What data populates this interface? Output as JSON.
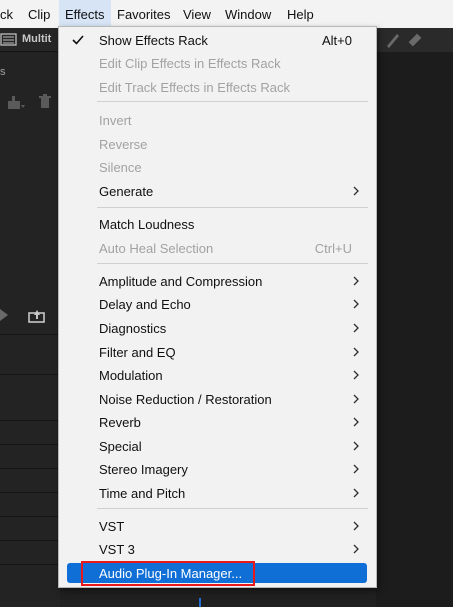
{
  "menubar": {
    "items": [
      {
        "label": "ck"
      },
      {
        "label": "Clip"
      },
      {
        "label": "Effects"
      },
      {
        "label": "Favorites"
      },
      {
        "label": "View"
      },
      {
        "label": "Window"
      },
      {
        "label": "Help"
      }
    ],
    "active_item": "Effects"
  },
  "background": {
    "tab_label": "Multit",
    "left_subheading": "s"
  },
  "effects_menu": {
    "items": [
      {
        "label": "Show Effects Rack",
        "shortcut": "Alt+0",
        "checked": true,
        "enabled": true
      },
      {
        "label": "Edit Clip Effects in Effects Rack",
        "enabled": false
      },
      {
        "label": "Edit Track Effects in Effects Rack",
        "enabled": false
      },
      {
        "label": "Invert",
        "enabled": false
      },
      {
        "label": "Reverse",
        "enabled": false
      },
      {
        "label": "Silence",
        "enabled": false
      },
      {
        "label": "Generate",
        "enabled": true,
        "submenu": true
      },
      {
        "label": "Match Loudness",
        "enabled": true
      },
      {
        "label": "Auto Heal Selection",
        "shortcut": "Ctrl+U",
        "enabled": false
      },
      {
        "label": "Amplitude and Compression",
        "enabled": true,
        "submenu": true
      },
      {
        "label": "Delay and Echo",
        "enabled": true,
        "submenu": true
      },
      {
        "label": "Diagnostics",
        "enabled": true,
        "submenu": true
      },
      {
        "label": "Filter and EQ",
        "enabled": true,
        "submenu": true
      },
      {
        "label": "Modulation",
        "enabled": true,
        "submenu": true
      },
      {
        "label": "Noise Reduction / Restoration",
        "enabled": true,
        "submenu": true
      },
      {
        "label": "Reverb",
        "enabled": true,
        "submenu": true
      },
      {
        "label": "Special",
        "enabled": true,
        "submenu": true
      },
      {
        "label": "Stereo Imagery",
        "enabled": true,
        "submenu": true
      },
      {
        "label": "Time and Pitch",
        "enabled": true,
        "submenu": true
      },
      {
        "label": "VST",
        "enabled": true,
        "submenu": true
      },
      {
        "label": "VST 3",
        "enabled": true,
        "submenu": true
      },
      {
        "label": "Audio Plug-In Manager...",
        "enabled": true,
        "highlighted": true
      }
    ]
  },
  "colors": {
    "highlight": "#0f6fd6",
    "annotation_box": "#e8191b",
    "menu_bg": "#f2f2f2",
    "disabled_text": "#a2a2a2"
  }
}
